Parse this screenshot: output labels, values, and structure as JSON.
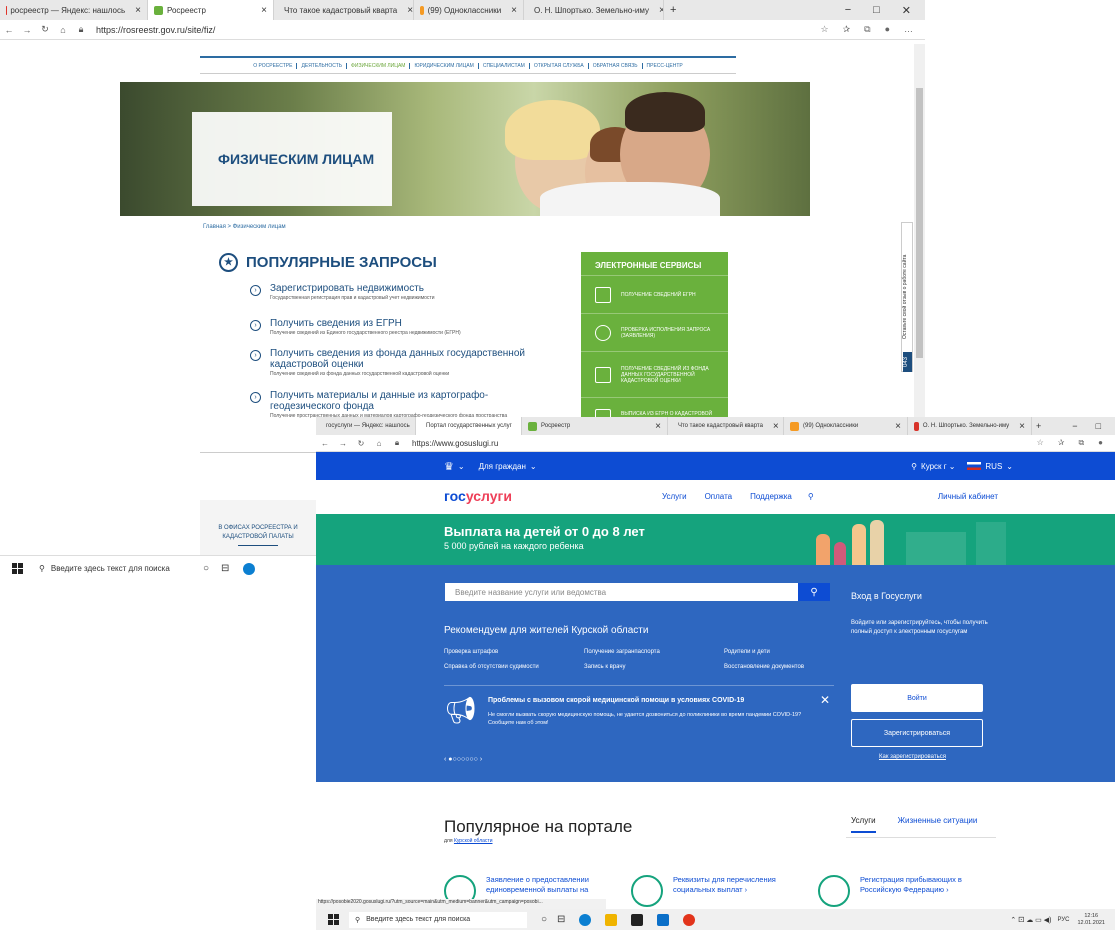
{
  "win1": {
    "tabs": [
      {
        "label": "росреестр — Яндекс: нашлось",
        "color": "#e0342a"
      },
      {
        "label": "Росреестр",
        "color": "#6ab13d"
      },
      {
        "label": "Что такое кадастровый кварта",
        "color": "#333333"
      },
      {
        "label": "(99) Одноклассники",
        "color": "#f59a23"
      },
      {
        "label": "О. Н. Шпортько. Земельно-иму",
        "color": "#d8332a"
      }
    ],
    "new_tab": "+",
    "controls": [
      "−",
      "□",
      "✕"
    ],
    "url": "https://rosreestr.gov.ru/site/fiz/",
    "nav": [
      "О РОСРЕЕСТРЕ",
      "ДЕЯТЕЛЬНОСТЬ",
      "ФИЗИЧЕСКИМ ЛИЦАМ",
      "ЮРИДИЧЕСКИМ ЛИЦАМ",
      "СПЕЦИАЛИСТАМ",
      "ОТКРЫТАЯ СЛУЖБА",
      "ОБРАТНАЯ СВЯЗЬ",
      "ПРЕСС-ЦЕНТР"
    ],
    "banner_title": "ФИЗИЧЕСКИМ ЛИЦАМ",
    "breadcrumb": "Главная > Физическим лицам",
    "popular_title": "ПОПУЛЯРНЫЕ ЗАПРОСЫ",
    "queries": [
      {
        "title": "Зарегистрировать недвижимость",
        "sub": "Государственная регистрация прав и кадастровый учет недвижимости"
      },
      {
        "title": "Получить сведения из ЕГРН",
        "sub": "Получение сведений из Единого государственного реестра недвижимости (ЕГРН)"
      },
      {
        "title": "Получить сведения из фонда данных государственной кадастровой оценки",
        "sub": "Получение сведений из фонда данных государственной кадастровой оценки"
      },
      {
        "title": "Получить материалы и данные из картографо-геодезического фонда",
        "sub": "Получение пространственных данных и материалов картографо-геодезического фонда пространства"
      }
    ],
    "services_title": "ЭЛЕКТРОННЫЕ СЕРВИСЫ",
    "services": [
      "ПОЛУЧЕНИЕ СВЕДЕНИЙ ЕГРН",
      "ПРОВЕРКА ИСПОЛНЕНИЯ ЗАПРОСА (ЗАЯВЛЕНИЯ)",
      "ПОЛУЧЕНИЕ СВЕДЕНИЙ ИЗ ФОНДА ДАННЫХ ГОСУДАРСТВЕННОЙ КАДАСТРОВОЙ ОЦЕНКИ",
      "ВЫПИСКА ИЗ ЕГРН О КАДАСТРОВОЙ СТОИМОСТИ"
    ],
    "feedback": "Оставьте свой отзыв о работе сайта",
    "feedback_count": "043",
    "office": "В ОФИСАХ РОСРЕЕСТРА И КАДАСТРОВОЙ ПАЛАТЫ",
    "taskbar_search": "Введите здесь текст для поиска"
  },
  "win2": {
    "tabs": [
      {
        "label": "госуслуги — Яндекс: нашлось",
        "color": "#e0342a"
      },
      {
        "label": "Портал государственных услуг",
        "color": "#0d4cd3"
      },
      {
        "label": "Росреестр",
        "color": "#6ab13d"
      },
      {
        "label": "Что такое кадастровый кварта",
        "color": "#333333"
      },
      {
        "label": "(99) Одноклассники",
        "color": "#f59a23"
      },
      {
        "label": "О. Н. Шпортько. Земельно-иму",
        "color": "#d8332a"
      }
    ],
    "new_tab": "+",
    "controls": [
      "−",
      "□"
    ],
    "url": "https://www.gosuslugi.ru",
    "top": {
      "citizens": "Для граждан",
      "region": "Курск г",
      "lang": "RUS"
    },
    "logo": {
      "a": "гос",
      "b": "услуги"
    },
    "menu": [
      "Услуги",
      "Оплата",
      "Поддержка"
    ],
    "cabinet": "Личный кабинет",
    "promo": {
      "title": "Выплата на детей от 0 до 8 лет",
      "sub": "5 000 рублей на каждого ребенка"
    },
    "search_placeholder": "Введите название услуги или ведомства",
    "rec_title": "Рекомендуем для жителей Курской области",
    "rec_links": [
      "Проверка штрафов",
      "Получение загранпаспорта",
      "Родители и дети",
      "Справка об отсутствии судимости",
      "Запись к врачу",
      "Восстановление документов"
    ],
    "covid": {
      "title": "Проблемы с вызовом скорой медицинской помощи в условиях COVID-19",
      "text": "Не смогли вызвать скорую медицинскую помощь, не удается дозвониться до поликлиники во время пандемии COVID-19? Сообщите нам об этом!"
    },
    "dots": "‹  ●○○○○○○  ›",
    "login": {
      "title": "Вход в Госуслуги",
      "text": "Войдите или зарегистрируйтесь, чтобы получить полный доступ к электронным госуслугам",
      "login_btn": "Войти",
      "register_btn": "Зарегистрироваться",
      "how": "Как зарегистрироваться"
    },
    "popular": {
      "title": "Популярное на портале",
      "sub_prefix": "для",
      "sub_link": "Курской области",
      "tab_on": "Услуги",
      "tab_off": "Жизненные ситуации"
    },
    "cards": [
      "Заявление о предоставлении единовременной выплаты на",
      "Реквизиты для перечисления социальных выплат  ›",
      "Регистрация прибывающих в Российскую Федерацию  ›"
    ],
    "status_url": "https://posobie2020.gosuslugi.ru/?utm_source=main&utm_medium=banner&utm_campaign=posobi...",
    "taskbar_search": "Введите здесь текст для поиска",
    "tray": {
      "lang": "РУС",
      "time": "12:16",
      "date": "12.01.2021"
    }
  }
}
